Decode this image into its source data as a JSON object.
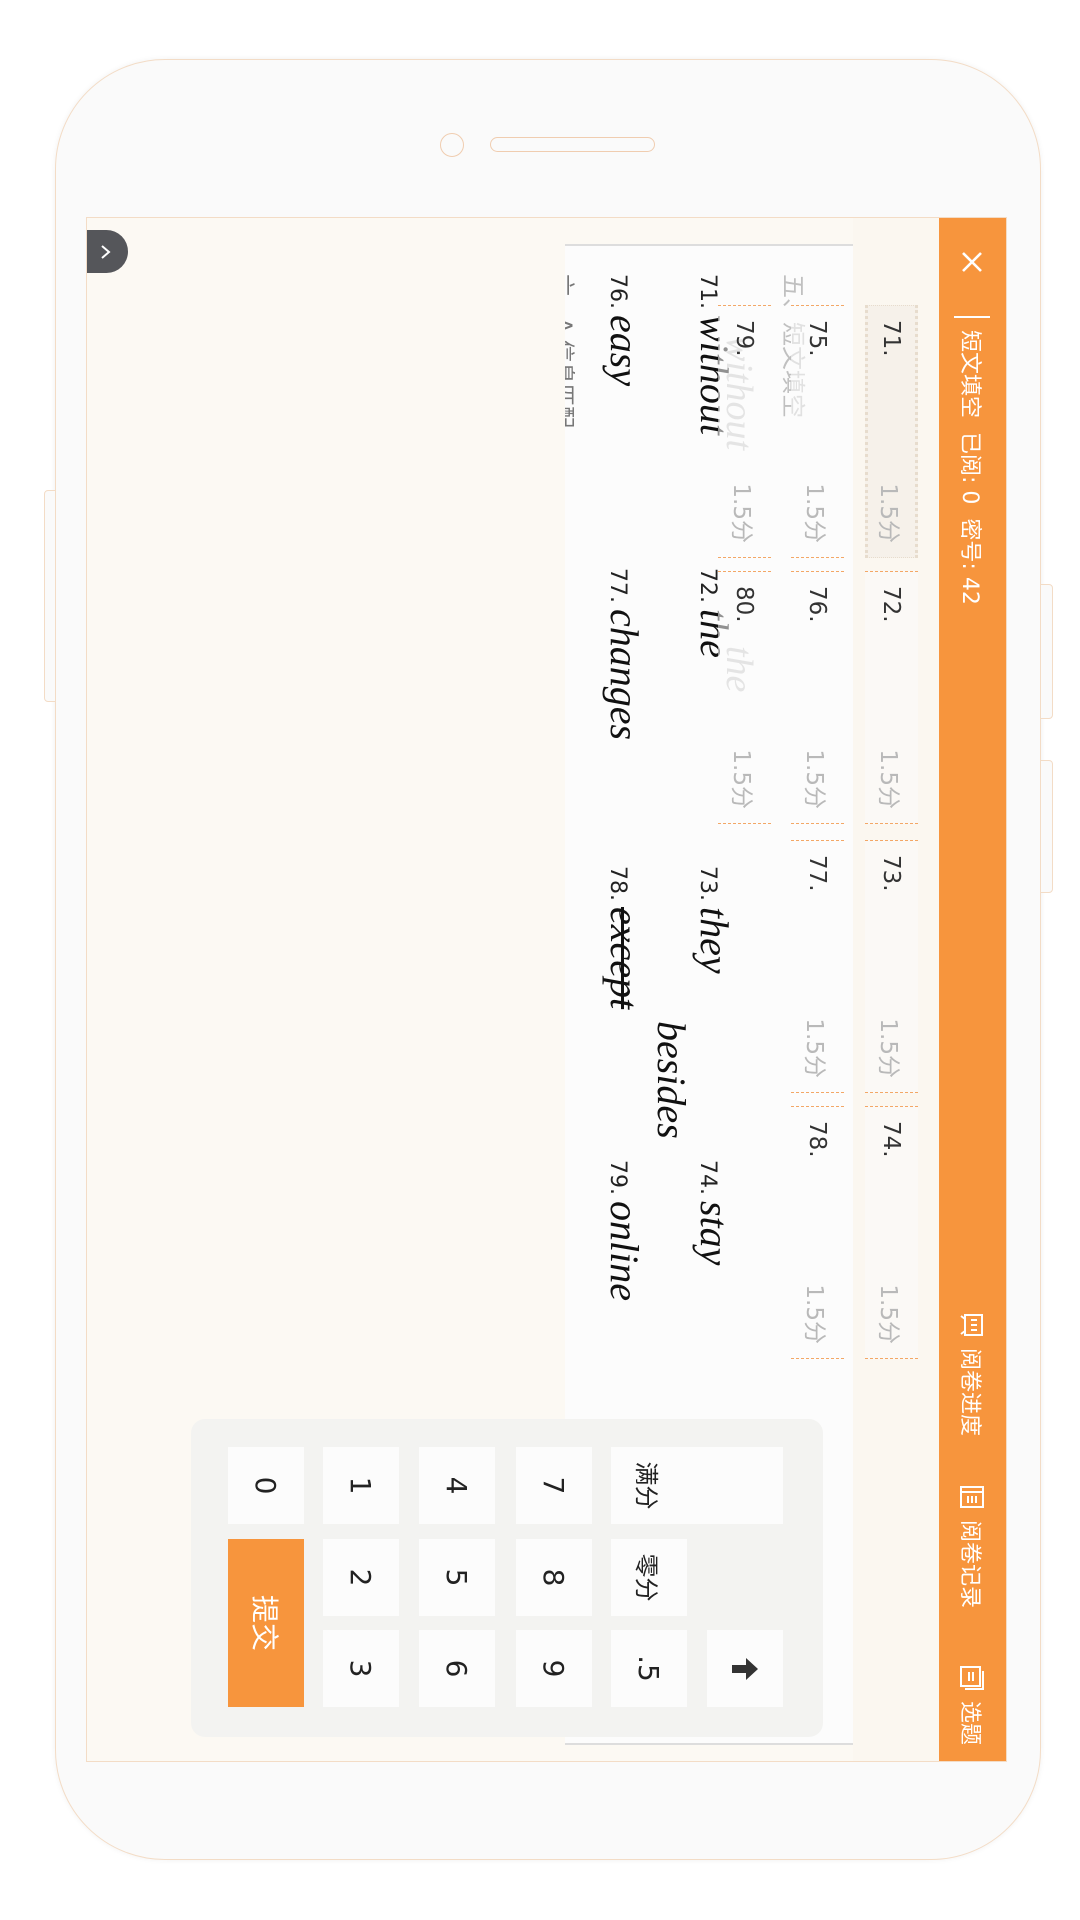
{
  "colors": {
    "accent": "#f7953d",
    "background": "#fcf9f3",
    "tab": "#55565a"
  },
  "header": {
    "close_icon": "close-icon",
    "title": "短文填空",
    "read_label": "已阅: 0",
    "code_label": "密号: 42",
    "actions": [
      {
        "icon": "progress-icon",
        "label": "阅卷进度"
      },
      {
        "icon": "record-icon",
        "label": "阅卷记录"
      },
      {
        "icon": "select-icon",
        "label": "选题"
      }
    ]
  },
  "scores": [
    {
      "num": "71.",
      "points": "1.5分",
      "active": true
    },
    {
      "num": "72.",
      "points": "1.5分"
    },
    {
      "num": "73.",
      "points": "1.5分"
    },
    {
      "num": "74.",
      "points": "1.5分"
    },
    {
      "num": "75.",
      "points": "1.5分"
    },
    {
      "num": "76.",
      "points": "1.5分"
    },
    {
      "num": "77.",
      "points": "1.5分"
    },
    {
      "num": "78.",
      "points": "1.5分"
    },
    {
      "num": "79.",
      "points": "1.5分"
    },
    {
      "num": "80.",
      "points": "1.5分"
    }
  ],
  "sheet": {
    "section_title": "五、短文填空",
    "next_section": "六、A 信息匹配",
    "answers": [
      {
        "num": "71.",
        "text": "without"
      },
      {
        "num": "72.",
        "text": "the"
      },
      {
        "num": "73.",
        "text": "they"
      },
      {
        "num": "74.",
        "text": "stay"
      },
      {
        "num": "76.",
        "text": "easy"
      },
      {
        "num": "77.",
        "text": "changes"
      },
      {
        "num": "78.",
        "text": "except",
        "struck": true,
        "correction": "besides"
      },
      {
        "num": "79.",
        "text": "online"
      }
    ]
  },
  "keypad": {
    "keys": [
      "满分",
      "零分",
      ".5",
      "7",
      "8",
      "9",
      "4",
      "5",
      "6",
      "1",
      "2",
      "3",
      "0"
    ],
    "backspace_icon": "arrow-up-icon",
    "submit": "提交"
  }
}
